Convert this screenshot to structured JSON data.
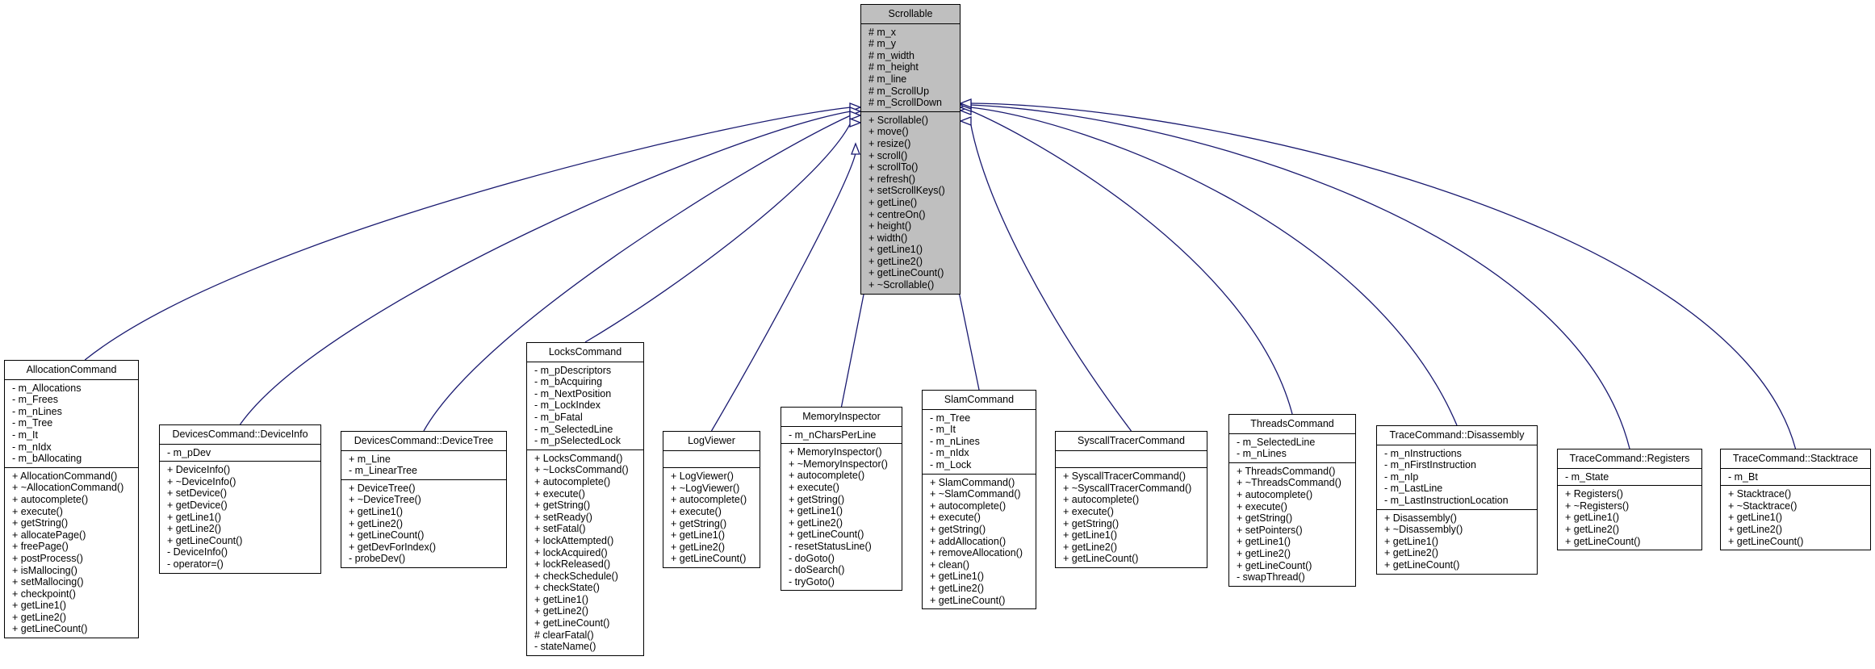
{
  "diagram": {
    "type": "class-inheritance",
    "edge_color": "#191970",
    "base_fill": "#bfbfbf",
    "base": {
      "name": "Scrollable",
      "attributes": [
        "# m_x",
        "# m_y",
        "# m_width",
        "# m_height",
        "# m_line",
        "# m_ScrollUp",
        "# m_ScrollDown"
      ],
      "methods": [
        "+ Scrollable()",
        "+ move()",
        "+ resize()",
        "+ scroll()",
        "+ scrollTo()",
        "+ refresh()",
        "+ setScrollKeys()",
        "+ getLine()",
        "+ centreOn()",
        "+ height()",
        "+ width()",
        "+ getLine1()",
        "+ getLine2()",
        "+ getLineCount()",
        "+ ~Scrollable()"
      ]
    },
    "classes": [
      {
        "name": "AllocationCommand",
        "attributes": [
          "- m_Allocations",
          "- m_Frees",
          "- m_nLines",
          "- m_Tree",
          "- m_It",
          "- m_nIdx",
          "- m_bAllocating"
        ],
        "methods": [
          "+ AllocationCommand()",
          "+ ~AllocationCommand()",
          "+ autocomplete()",
          "+ execute()",
          "+ getString()",
          "+ allocatePage()",
          "+ freePage()",
          "+ postProcess()",
          "+ isMallocing()",
          "+ setMallocing()",
          "+ checkpoint()",
          "+ getLine1()",
          "+ getLine2()",
          "+ getLineCount()"
        ]
      },
      {
        "name": "DevicesCommand::DeviceInfo",
        "attributes": [
          "- m_pDev"
        ],
        "methods": [
          "+ DeviceInfo()",
          "+ ~DeviceInfo()",
          "+ setDevice()",
          "+ getDevice()",
          "+ getLine1()",
          "+ getLine2()",
          "+ getLineCount()",
          "- DeviceInfo()",
          "- operator=()"
        ]
      },
      {
        "name": "DevicesCommand::DeviceTree",
        "attributes": [
          "+ m_Line",
          "- m_LinearTree"
        ],
        "methods": [
          "+ DeviceTree()",
          "+ ~DeviceTree()",
          "+ getLine1()",
          "+ getLine2()",
          "+ getLineCount()",
          "+ getDevForIndex()",
          "- probeDev()"
        ]
      },
      {
        "name": "LocksCommand",
        "attributes": [
          "- m_pDescriptors",
          "- m_bAcquiring",
          "- m_NextPosition",
          "- m_LockIndex",
          "- m_bFatal",
          "- m_SelectedLine",
          "- m_pSelectedLock"
        ],
        "methods": [
          "+ LocksCommand()",
          "+ ~LocksCommand()",
          "+ autocomplete()",
          "+ execute()",
          "+ getString()",
          "+ setReady()",
          "+ setFatal()",
          "+ lockAttempted()",
          "+ lockAcquired()",
          "+ lockReleased()",
          "+ checkSchedule()",
          "+ checkState()",
          "+ getLine1()",
          "+ getLine2()",
          "+ getLineCount()",
          "# clearFatal()",
          "- stateName()"
        ]
      },
      {
        "name": "LogViewer",
        "attributes": [],
        "methods": [
          "+ LogViewer()",
          "+ ~LogViewer()",
          "+ autocomplete()",
          "+ execute()",
          "+ getString()",
          "+ getLine1()",
          "+ getLine2()",
          "+ getLineCount()"
        ]
      },
      {
        "name": "MemoryInspector",
        "attributes": [
          "- m_nCharsPerLine"
        ],
        "methods": [
          "+ MemoryInspector()",
          "+ ~MemoryInspector()",
          "+ autocomplete()",
          "+ execute()",
          "+ getString()",
          "+ getLine1()",
          "+ getLine2()",
          "+ getLineCount()",
          "- resetStatusLine()",
          "- doGoto()",
          "- doSearch()",
          "- tryGoto()"
        ]
      },
      {
        "name": "SlamCommand",
        "attributes": [
          "- m_Tree",
          "- m_It",
          "- m_nLines",
          "- m_nIdx",
          "- m_Lock"
        ],
        "methods": [
          "+ SlamCommand()",
          "+ ~SlamCommand()",
          "+ autocomplete()",
          "+ execute()",
          "+ getString()",
          "+ addAllocation()",
          "+ removeAllocation()",
          "+ clean()",
          "+ getLine1()",
          "+ getLine2()",
          "+ getLineCount()"
        ]
      },
      {
        "name": "SyscallTracerCommand",
        "attributes": [],
        "methods": [
          "+ SyscallTracerCommand()",
          "+ ~SyscallTracerCommand()",
          "+ autocomplete()",
          "+ execute()",
          "+ getString()",
          "+ getLine1()",
          "+ getLine2()",
          "+ getLineCount()"
        ]
      },
      {
        "name": "ThreadsCommand",
        "attributes": [
          "- m_SelectedLine",
          "- m_nLines"
        ],
        "methods": [
          "+ ThreadsCommand()",
          "+ ~ThreadsCommand()",
          "+ autocomplete()",
          "+ execute()",
          "+ getString()",
          "+ setPointers()",
          "+ getLine1()",
          "+ getLine2()",
          "+ getLineCount()",
          "- swapThread()"
        ]
      },
      {
        "name": "TraceCommand::Disassembly",
        "attributes": [
          "- m_nInstructions",
          "- m_nFirstInstruction",
          "- m_nIp",
          "- m_LastLine",
          "- m_LastInstructionLocation"
        ],
        "methods": [
          "+ Disassembly()",
          "+ ~Disassembly()",
          "+ getLine1()",
          "+ getLine2()",
          "+ getLineCount()"
        ]
      },
      {
        "name": "TraceCommand::Registers",
        "attributes": [
          "- m_State"
        ],
        "methods": [
          "+ Registers()",
          "+ ~Registers()",
          "+ getLine1()",
          "+ getLine2()",
          "+ getLineCount()"
        ]
      },
      {
        "name": "TraceCommand::Stacktrace",
        "attributes": [
          "- m_Bt"
        ],
        "methods": [
          "+ Stacktrace()",
          "+ ~Stacktrace()",
          "+ getLine1()",
          "+ getLine2()",
          "+ getLineCount()"
        ]
      }
    ]
  }
}
